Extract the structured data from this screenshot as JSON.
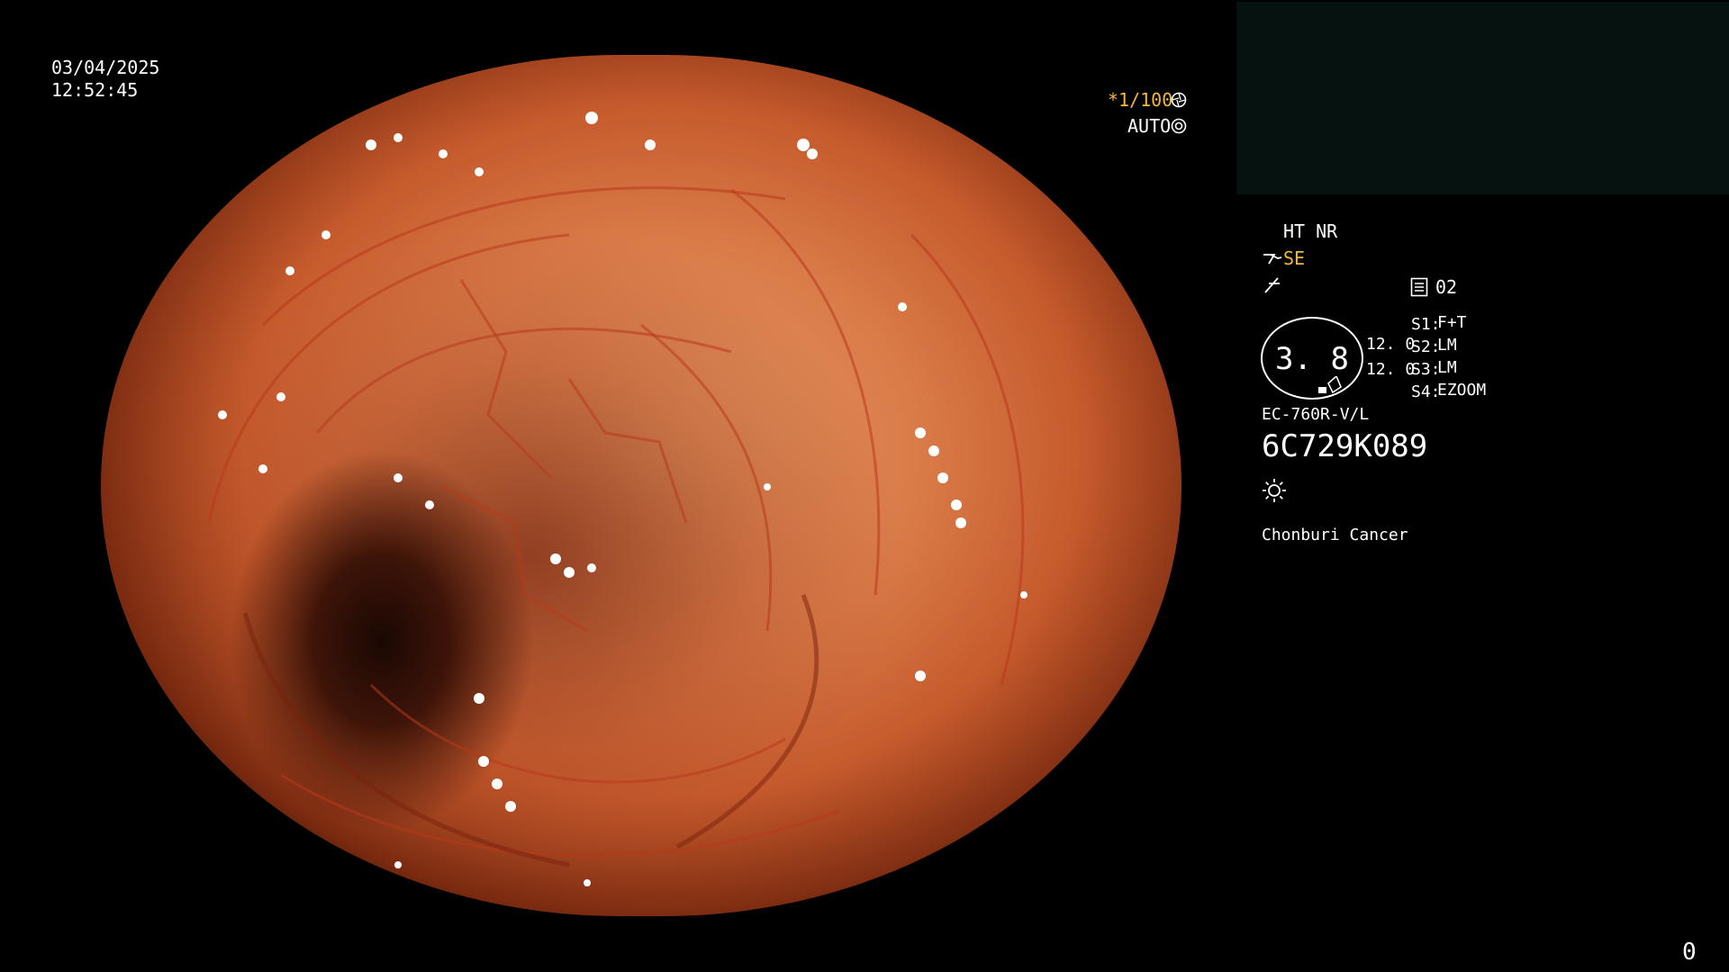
{
  "datetime": {
    "date": "03/04/2025",
    "time": "12:52:45"
  },
  "shutter": {
    "speed": "*1/100",
    "mode": "AUTO"
  },
  "settings": {
    "ht_nr": "HT NR",
    "se": "SE",
    "memory_index": "02",
    "circle_value": "3. 8",
    "values": [
      "12. 0",
      "12. 0"
    ],
    "switches": [
      {
        "key": "S1:",
        "value": "F+T"
      },
      {
        "key": "S2:",
        "value": "LM"
      },
      {
        "key": "S3:",
        "value": "LM"
      },
      {
        "key": "S4:",
        "value": "EZOOM"
      }
    ]
  },
  "scope": {
    "model": "EC-760R-V/L",
    "serial": "6C729K089"
  },
  "facility": "Chonburi Cancer",
  "counter": "0",
  "icons": [
    "shutter-icon",
    "auto-iris-icon",
    "scope-se-icon",
    "bend-icon",
    "memory-icon",
    "light-icon"
  ],
  "colors": {
    "accent_yellow": "#f2b83a",
    "text": "#ffffff",
    "background": "#000000"
  }
}
